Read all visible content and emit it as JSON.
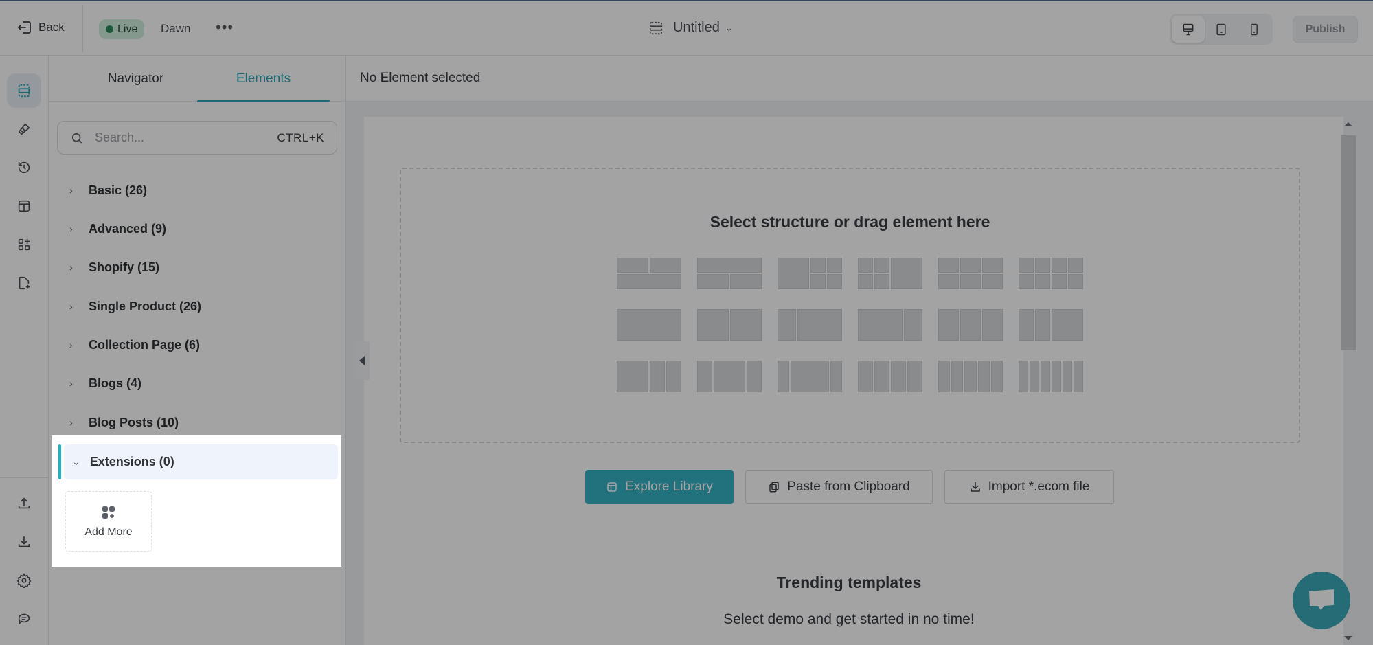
{
  "topbar": {
    "back_label": "Back",
    "status_badge": "Live",
    "theme_name": "Dawn",
    "more_label": "•••",
    "page_title": "Untitled",
    "devices": [
      "desktop",
      "tablet",
      "mobile"
    ],
    "active_device": "desktop",
    "publish_label": "Publish"
  },
  "rail": {
    "top_items": [
      {
        "icon": "sections-icon",
        "active": true
      },
      {
        "icon": "brush-icon"
      },
      {
        "icon": "history-icon"
      },
      {
        "icon": "layout-icon"
      },
      {
        "icon": "apps-add-icon"
      },
      {
        "icon": "page-add-icon"
      }
    ],
    "bottom_items": [
      {
        "icon": "upload-icon"
      },
      {
        "icon": "download-icon"
      },
      {
        "icon": "settings-icon"
      },
      {
        "icon": "feedback-icon"
      }
    ]
  },
  "panel": {
    "tabs": [
      {
        "label": "Navigator",
        "active": false
      },
      {
        "label": "Elements",
        "active": true
      }
    ],
    "search": {
      "placeholder": "Search...",
      "value": "",
      "shortcut": "CTRL+K"
    },
    "categories": [
      {
        "label": "Basic (26)",
        "expanded": false
      },
      {
        "label": "Advanced (9)",
        "expanded": false
      },
      {
        "label": "Shopify (15)",
        "expanded": false
      },
      {
        "label": "Single Product (26)",
        "expanded": false
      },
      {
        "label": "Collection Page (6)",
        "expanded": false
      },
      {
        "label": "Blogs (4)",
        "expanded": false
      },
      {
        "label": "Blog Posts (10)",
        "expanded": false
      },
      {
        "label": "Extensions (0)",
        "expanded": true
      }
    ],
    "add_more_label": "Add More"
  },
  "main": {
    "header": "No Element selected",
    "dropzone_title": "Select structure or drag element here",
    "actions": {
      "explore": "Explore Library",
      "paste": "Paste from Clipboard",
      "import": "Import *.ecom file"
    },
    "trending_title": "Trending templates",
    "trending_subtitle": "Select demo and get started in no time!"
  },
  "colors": {
    "accent": "#2aa5b5",
    "primary_button": "#36b3c6",
    "live_badge_bg": "#cfeede",
    "live_dot": "#2e8a5f",
    "highlight_row": "#eef3fc",
    "highlight_bar": "#1ab3c8"
  }
}
